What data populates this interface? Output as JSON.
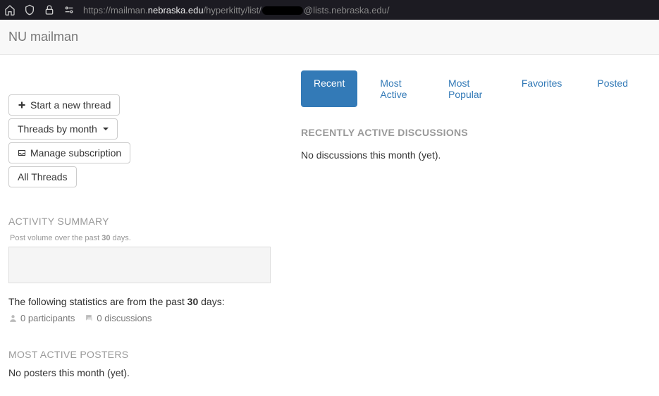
{
  "browser": {
    "url_prefix": "https://mailman.",
    "url_domain": "nebraska.edu",
    "url_path1": "/hyperkitty/list/",
    "url_path2": "@lists.nebraska.edu/"
  },
  "header": {
    "title": "NU mailman"
  },
  "sidebar": {
    "new_thread_label": "Start a new thread",
    "threads_by_month_label": "Threads by month",
    "manage_subscription_label": "Manage subscription",
    "all_threads_label": "All Threads",
    "activity_summary_heading": "ACTIVITY SUMMARY",
    "post_volume_label": "Post volume over the past 30 days.",
    "stats_intro_prefix": "The following statistics are from the past ",
    "stats_days": "30",
    "stats_intro_suffix": " days:",
    "participants_count": "0",
    "participants_label": "participants",
    "discussions_count": "0",
    "discussions_label": "discussions",
    "most_active_posters_heading": "MOST ACTIVE POSTERS",
    "no_posters_msg": "No posters this month (yet)."
  },
  "main": {
    "tabs": {
      "recent": "Recent",
      "most_active": "Most Active",
      "most_popular": "Most Popular",
      "favorites": "Favorites",
      "posted": "Posted"
    },
    "active_tab": "recent",
    "subheading": "RECENTLY ACTIVE DISCUSSIONS",
    "empty_msg": "No discussions this month (yet)."
  }
}
